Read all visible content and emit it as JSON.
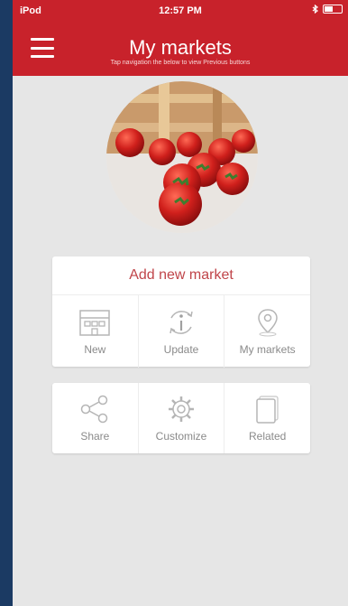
{
  "status_bar": {
    "carrier": "iPod",
    "time": "12:57 PM",
    "battery_level": 0.5
  },
  "header": {
    "title": "My markets",
    "subtitle": "Tap navigation the below to view Previous buttons"
  },
  "hero": {
    "icon": "cherry-tomatoes-photo"
  },
  "card1": {
    "add_label": "Add new market",
    "tiles": [
      {
        "label": "New",
        "icon": "building-icon"
      },
      {
        "label": "Update",
        "icon": "info-refresh-icon"
      },
      {
        "label": "My markets",
        "icon": "map-pin-icon"
      }
    ]
  },
  "card2": {
    "tiles": [
      {
        "label": "Share",
        "icon": "share-icon"
      },
      {
        "label": "Customize",
        "icon": "gear-icon"
      },
      {
        "label": "Related",
        "icon": "document-icon"
      }
    ]
  },
  "colors": {
    "header": "#c8222b",
    "background": "#e6e6e6",
    "accent_text": "#c0454a"
  }
}
